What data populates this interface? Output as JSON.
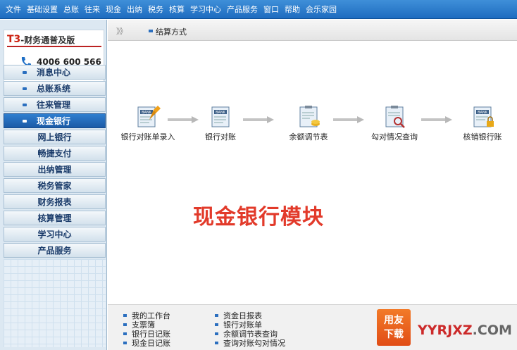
{
  "menu": [
    "文件",
    "基础设置",
    "总账",
    "往来",
    "现金",
    "出纳",
    "税务",
    "核算",
    "学习中心",
    "产品服务",
    "窗口",
    "帮助",
    "会乐家园"
  ],
  "brand": {
    "t3": "T3",
    "title_rest": "-财务通普及版",
    "phone": "4006 600 566"
  },
  "nav": [
    {
      "label": "消息中心",
      "bullet": true,
      "active": false
    },
    {
      "label": "总账系统",
      "bullet": true,
      "active": false
    },
    {
      "label": "往来管理",
      "bullet": true,
      "active": false
    },
    {
      "label": "现金银行",
      "bullet": true,
      "active": true
    },
    {
      "label": "网上银行",
      "bullet": false,
      "active": false
    },
    {
      "label": "畅捷支付",
      "bullet": false,
      "active": false
    },
    {
      "label": "出纳管理",
      "bullet": false,
      "active": false
    },
    {
      "label": "税务管家",
      "bullet": false,
      "active": false
    },
    {
      "label": "财务报表",
      "bullet": false,
      "active": false
    },
    {
      "label": "核算管理",
      "bullet": false,
      "active": false
    },
    {
      "label": "学习中心",
      "bullet": false,
      "active": false
    },
    {
      "label": "产品服务",
      "bullet": false,
      "active": false
    }
  ],
  "breadcrumb": {
    "arrows": "》》",
    "label": "结算方式"
  },
  "flow": [
    {
      "label": "银行对账单录入",
      "icon_text": "BANK"
    },
    {
      "label": "银行对账",
      "icon_text": "BANK"
    },
    {
      "label": "余额调节表",
      "icon_text": ""
    },
    {
      "label": "勾对情况查询",
      "icon_text": ""
    },
    {
      "label": "核销银行账",
      "icon_text": "BANK"
    }
  ],
  "big_title": "现金银行模块",
  "quick_links": {
    "col1": [
      "我的工作台",
      "支票簿",
      "银行日记账",
      "现金日记账"
    ],
    "col2": [
      "资金日报表",
      "银行对账单",
      "余额调节表查询",
      "查询对账勾对情况"
    ]
  },
  "watermark": {
    "badge_top": "用友",
    "badge_bottom": "下载",
    "site": "YYRJXZ",
    "dot": ".COM"
  },
  "colors": {
    "menubar": "#1e6cc0",
    "active_nav": "#1b5aa6",
    "title_red": "#e23a2a"
  }
}
